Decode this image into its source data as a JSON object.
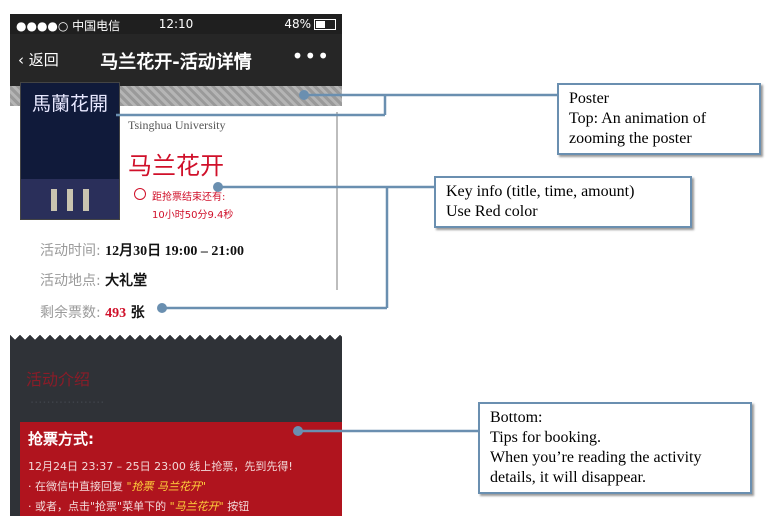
{
  "status": {
    "signal": "●●●●○ 中国电信",
    "time": "12:10",
    "battery": "48%"
  },
  "nav": {
    "back": "返回",
    "title": "马兰花开-活动详情",
    "more": "•••"
  },
  "poster": {
    "title": "馬蘭花開"
  },
  "event": {
    "university": "Tsinghua University",
    "name": "马兰花开",
    "countdown_label": "距抢票结束还有:",
    "countdown_value": "10小时50分9.4秒",
    "time_label": "活动时间:",
    "time_value": "12月30日 19:00 – 21:00",
    "place_label": "活动地点:",
    "place_value": "大礼堂",
    "tickets_label": "剩余票数:",
    "tickets_value": "493",
    "tickets_unit": "张"
  },
  "intro": {
    "heading": "活动介绍",
    "ghost": "··················"
  },
  "booking": {
    "heading": "抢票方式:",
    "line1": "12月24日 23:37 – 25日 23:00 线上抢票，先到先得!",
    "line2_pre": "· 在微信中直接回复",
    "line2_em": "\"抢票   马兰花开\"",
    "line3_pre": "· 或者，点击\"抢票\"菜单下的",
    "line3_em": "\"马兰花开\"",
    "line3_post": "按钮"
  },
  "annotations": {
    "poster": "Poster\nTop: An animation of\nzooming the poster",
    "keyinfo": "Key info (title, time, amount)\nUse Red color",
    "bottom": "Bottom:\nTips for booking.\nWhen you’re reading the activity\ndetails, it will disappear."
  },
  "colors": {
    "accent": "#d0102a",
    "navbar": "#262626",
    "callout_border": "#6a8fb0"
  }
}
